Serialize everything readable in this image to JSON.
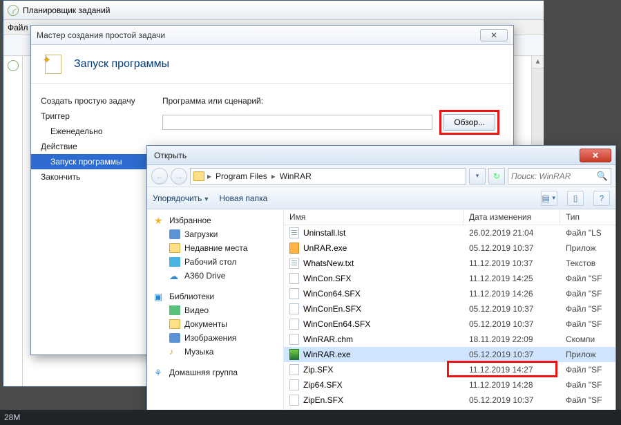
{
  "task_scheduler": {
    "title": "Планировщик заданий",
    "menu": {
      "file": "Файл"
    }
  },
  "wizard": {
    "title": "Мастер создания простой задачи",
    "heading": "Запуск программы",
    "steps": {
      "create": "Создать простую задачу",
      "trigger": "Триггер",
      "weekly": "Еженедельно",
      "action": "Действие",
      "runprog": "Запуск программы",
      "finish": "Закончить"
    },
    "field_label": "Программа или сценарий:",
    "browse": "Обзор..."
  },
  "filedlg": {
    "title": "Открыть",
    "crumb1": "Program Files",
    "crumb2": "WinRAR",
    "search_placeholder": "Поиск: WinRAR",
    "organize": "Упорядочить",
    "newfolder": "Новая папка",
    "nav": {
      "fav": "Избранное",
      "downloads": "Загрузки",
      "recent": "Недавние места",
      "desktop": "Рабочий стол",
      "a360": "A360 Drive",
      "libs": "Библиотеки",
      "video": "Видео",
      "docs": "Документы",
      "pics": "Изображения",
      "music": "Музыка",
      "home": "Домашняя группа"
    },
    "columns": {
      "name": "Имя",
      "date": "Дата изменения",
      "type": "Тип"
    },
    "files": [
      {
        "name": "Uninstall.lst",
        "date": "26.02.2019 21:04",
        "type": "Файл \"LS",
        "ico": "file-ico txt"
      },
      {
        "name": "UnRAR.exe",
        "date": "05.12.2019 10:37",
        "type": "Прилож",
        "ico": "file-ico exe"
      },
      {
        "name": "WhatsNew.txt",
        "date": "11.12.2019 10:37",
        "type": "Текстов",
        "ico": "file-ico txt"
      },
      {
        "name": "WinCon.SFX",
        "date": "11.12.2019 14:25",
        "type": "Файл \"SF",
        "ico": "file-ico"
      },
      {
        "name": "WinCon64.SFX",
        "date": "11.12.2019 14:26",
        "type": "Файл \"SF",
        "ico": "file-ico"
      },
      {
        "name": "WinConEn.SFX",
        "date": "05.12.2019 10:37",
        "type": "Файл \"SF",
        "ico": "file-ico"
      },
      {
        "name": "WinConEn64.SFX",
        "date": "05.12.2019 10:37",
        "type": "Файл \"SF",
        "ico": "file-ico"
      },
      {
        "name": "WinRAR.chm",
        "date": "18.11.2019 22:09",
        "type": "Скомпи",
        "ico": "file-ico chm"
      },
      {
        "name": "WinRAR.exe",
        "date": "05.12.2019 10:37",
        "type": "Прилож",
        "ico": "file-ico rar",
        "selected": true
      },
      {
        "name": "Zip.SFX",
        "date": "11.12.2019 14:27",
        "type": "Файл \"SF",
        "ico": "file-ico"
      },
      {
        "name": "Zip64.SFX",
        "date": "11.12.2019 14:28",
        "type": "Файл \"SF",
        "ico": "file-ico"
      },
      {
        "name": "ZipEn.SFX",
        "date": "05.12.2019 10:37",
        "type": "Файл \"SF",
        "ico": "file-ico"
      }
    ]
  },
  "taskbar": {
    "left": "28M"
  }
}
